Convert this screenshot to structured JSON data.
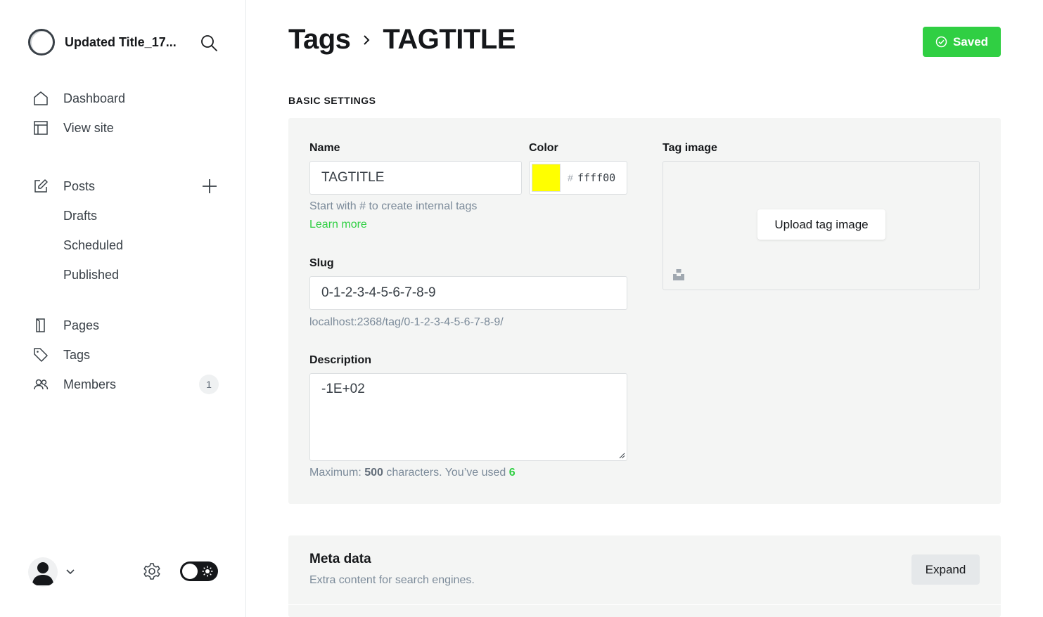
{
  "sidebar": {
    "site_title": "Updated Title_17...",
    "nav_primary": [
      {
        "label": "Dashboard",
        "icon": "home-icon"
      },
      {
        "label": "View site",
        "icon": "layout-icon"
      }
    ],
    "posts": {
      "label": "Posts",
      "subitems": [
        "Drafts",
        "Scheduled",
        "Published"
      ]
    },
    "nav_secondary": [
      {
        "label": "Pages",
        "icon": "page-icon"
      },
      {
        "label": "Tags",
        "icon": "tag-icon"
      },
      {
        "label": "Members",
        "icon": "members-icon",
        "count": "1"
      }
    ]
  },
  "header": {
    "breadcrumb_parent": "Tags",
    "breadcrumb_current": "TAGTITLE",
    "saved_label": "Saved"
  },
  "basic": {
    "section_label": "BASIC SETTINGS",
    "name_label": "Name",
    "name_value": "TAGTITLE",
    "color_label": "Color",
    "color_hash": "#",
    "color_value": "ffff00",
    "color_swatch": "#ffff00",
    "name_hint": "Start with # to create internal tags",
    "learn_more": "Learn more",
    "slug_label": "Slug",
    "slug_value": "0-1-2-3-4-5-6-7-8-9",
    "slug_url": "localhost:2368/tag/0-1-2-3-4-5-6-7-8-9/",
    "description_label": "Description",
    "description_value": "-1E+02",
    "max_prefix": "Maximum:",
    "max_count": "500",
    "max_mid": "characters. You’ve used",
    "used_count": "6",
    "tag_image_label": "Tag image",
    "upload_label": "Upload tag image"
  },
  "meta": {
    "title": "Meta data",
    "subtitle": "Extra content for search engines.",
    "expand_label": "Expand"
  },
  "colors": {
    "accent_green": "#30cf43",
    "panel_bg": "#f4f5f4"
  }
}
